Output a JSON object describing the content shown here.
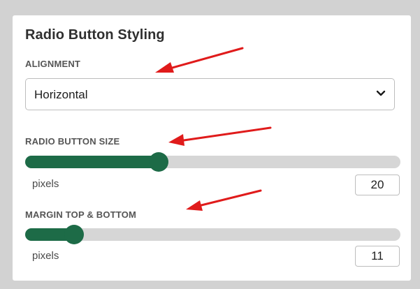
{
  "panel": {
    "title": "Radio Button Styling"
  },
  "alignment": {
    "label": "ALIGNMENT",
    "selected": "Horizontal"
  },
  "radio_size": {
    "label": "RADIO BUTTON SIZE",
    "unit": "pixels",
    "value": "20",
    "fraction": 0.355
  },
  "margin": {
    "label": "MARGIN TOP & BOTTOM",
    "unit": "pixels",
    "value": "11",
    "fraction": 0.13
  },
  "colors": {
    "accent": "#1d6b47",
    "track": "#d6d6d6",
    "annotation": "#e01b1b"
  },
  "icons": {
    "select": "chevron-down-icon",
    "annotation": "red-arrow-icon"
  }
}
